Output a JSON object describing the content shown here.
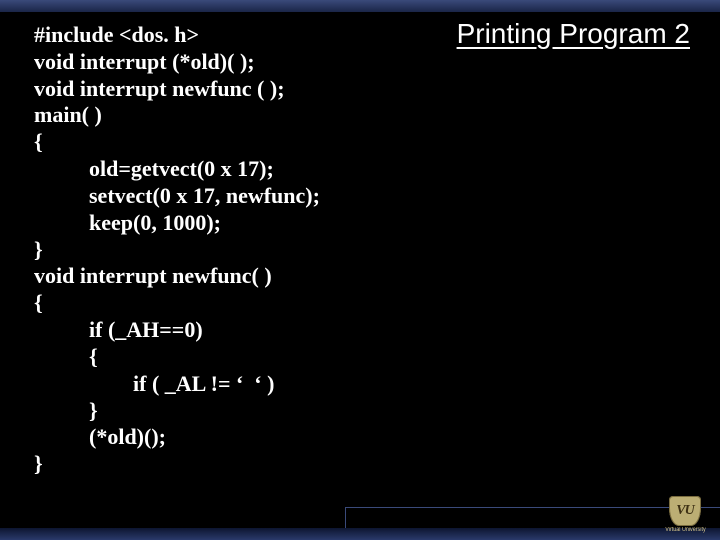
{
  "title": "Printing Program 2",
  "code": {
    "l01": "#include <dos. h>",
    "l02": "void interrupt (*old)( );",
    "l03": "void interrupt newfunc ( );",
    "l04": "main( )",
    "l05": "{",
    "l06": "          old=getvect(0 x 17);",
    "l07": "          setvect(0 x 17, newfunc);",
    "l08": "          keep(0, 1000);",
    "l09": "}",
    "l10": "void interrupt newfunc( )",
    "l11": "{",
    "l12": "          if (_AH==0)",
    "l13": "          {",
    "l14": "                  if ( _AL != ‘  ‘ )",
    "l15": "          }",
    "l16": "          (*old)();",
    "l17": "}"
  },
  "logo": {
    "initials": "VU",
    "caption": "Virtual University"
  }
}
